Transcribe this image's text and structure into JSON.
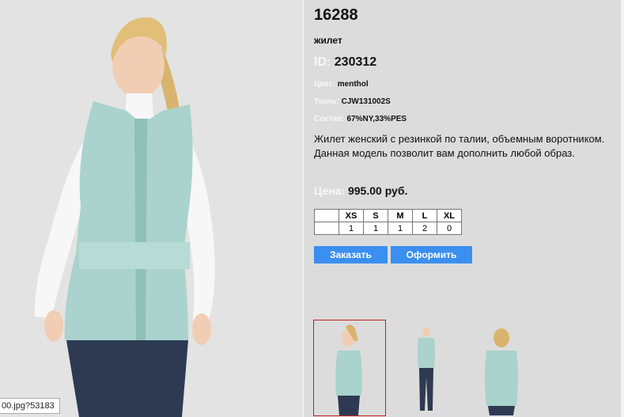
{
  "product": {
    "code": "16288",
    "type": "жилет",
    "id_label": "ID:",
    "id_value": "230312",
    "attributes": [
      {
        "label": "Цвет:",
        "value": "menthol"
      },
      {
        "label": "Ткань:",
        "value": "CJW131002S"
      },
      {
        "label": "Состав:",
        "value": "67%NY,33%PES"
      }
    ],
    "description": "Жилет женский с резинкой по талии, объемным воротником. Данная модель позволит вам дополнить любой образ.",
    "price_label": "Цена:",
    "price_value": "995.00 руб."
  },
  "sizes": {
    "headers": [
      "XS",
      "S",
      "M",
      "L",
      "XL"
    ],
    "quantities": [
      "1",
      "1",
      "1",
      "2",
      "0"
    ]
  },
  "buttons": {
    "order": "Заказать",
    "checkout": "Оформить"
  },
  "tooltip": "00.jpg?53183",
  "colors": {
    "accent": "#3b8ff0",
    "vest": "#a9d3cc",
    "selected_border": "#c41d1d"
  }
}
